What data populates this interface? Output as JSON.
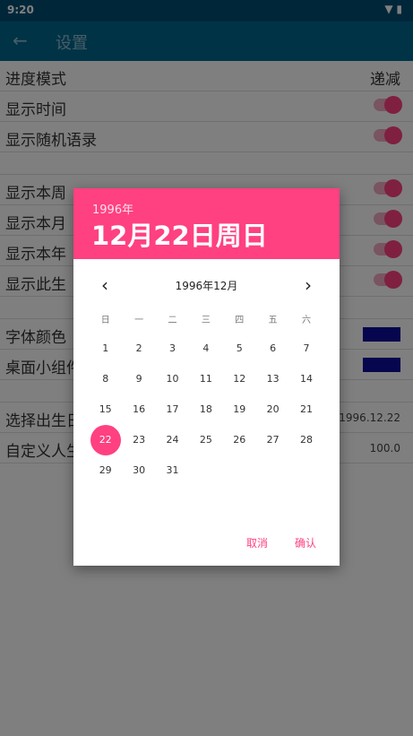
{
  "status": {
    "time": "9:20",
    "icons": "▼ ▮"
  },
  "appbar": {
    "back_icon": "←",
    "title": "设置"
  },
  "settings": {
    "progress_mode": {
      "label": "进度模式",
      "value": "递减"
    },
    "show_time": "显示时间",
    "show_quote": "显示随机语录",
    "show_week": "显示本周",
    "show_month": "显示本月",
    "show_year": "显示本年",
    "show_life": "显示此生",
    "font_color": "字体颜色",
    "widget_color": "桌面小组件",
    "birthday": {
      "label": "选择出生日",
      "value": "1996.12.22"
    },
    "custom_life": {
      "label": "自定义人生",
      "value": "100.0"
    },
    "swatch_color": "#0d0d9c"
  },
  "dialog": {
    "year": "1996年",
    "date": "12月22日周日",
    "month_title": "1996年12月",
    "prev_icon": "‹",
    "next_icon": "›",
    "weekdays": [
      "日",
      "一",
      "二",
      "三",
      "四",
      "五",
      "六"
    ],
    "weeks": [
      [
        "1",
        "2",
        "3",
        "4",
        "5",
        "6",
        "7"
      ],
      [
        "8",
        "9",
        "10",
        "11",
        "12",
        "13",
        "14"
      ],
      [
        "15",
        "16",
        "17",
        "18",
        "19",
        "20",
        "21"
      ],
      [
        "22",
        "23",
        "24",
        "25",
        "26",
        "27",
        "28"
      ],
      [
        "29",
        "30",
        "31",
        "",
        "",
        "",
        ""
      ]
    ],
    "selected_day": "22",
    "cancel": "取消",
    "confirm": "确认",
    "accent": "#ff4081"
  }
}
